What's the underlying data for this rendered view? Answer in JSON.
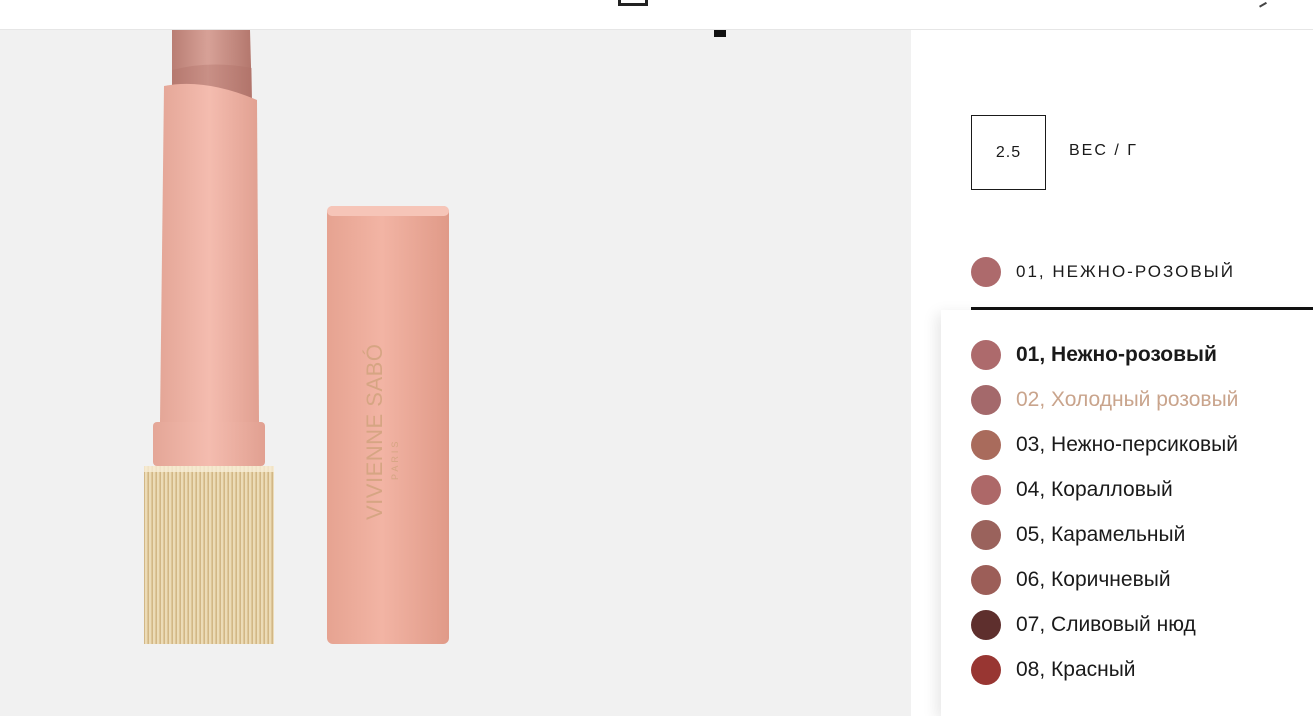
{
  "product": {
    "brand_line1": "VIVIENNE SABÓ",
    "brand_line2": "PARIS"
  },
  "weight": {
    "value": "2.5",
    "label": "ВЕС / Г"
  },
  "shade_select": {
    "current_label": "01, НЕЖНО-РОЗОВЫЙ",
    "current_color": "#ad6a6c"
  },
  "shades": [
    {
      "name": "01, Нежно-розовый",
      "color": "#ad6a6c",
      "state": "selected"
    },
    {
      "name": "02, Холодный розовый",
      "color": "#a4696b",
      "state": "hover"
    },
    {
      "name": "03, Нежно-персиковый",
      "color": "#a96b5c",
      "state": ""
    },
    {
      "name": "04, Коралловый",
      "color": "#ad6868",
      "state": ""
    },
    {
      "name": "05, Карамельный",
      "color": "#9a625c",
      "state": ""
    },
    {
      "name": "06, Коричневый",
      "color": "#9c5e58",
      "state": ""
    },
    {
      "name": "07, Сливовый нюд",
      "color": "#5e2f2d",
      "state": ""
    },
    {
      "name": "08, Красный",
      "color": "#983632",
      "state": ""
    }
  ],
  "colors": {
    "hover_text": "#c9a48c",
    "gallery_bg": "#f1f1f1"
  }
}
